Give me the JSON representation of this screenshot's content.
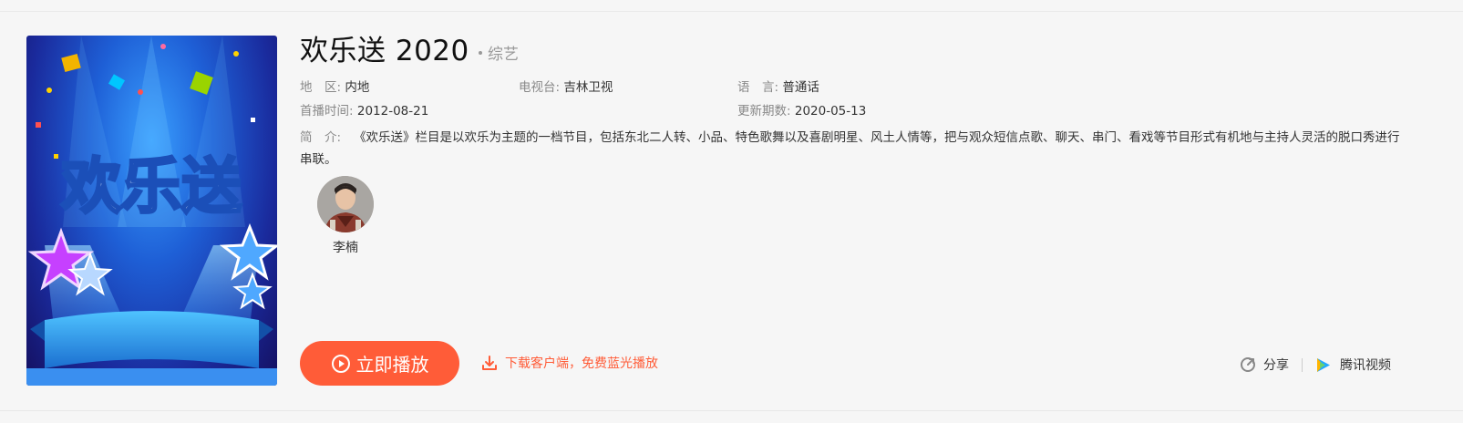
{
  "show": {
    "title": "欢乐送 2020",
    "genre": "综艺",
    "poster_text": "欢乐送"
  },
  "info": {
    "region_label": "地　区:",
    "region_value": "内地",
    "channel_label": "电视台:",
    "channel_value": "吉林卫视",
    "language_label": "语　言:",
    "language_value": "普通话",
    "premiere_label": "首播时间:",
    "premiere_value": "2012-08-21",
    "update_label": "更新期数:",
    "update_value": "2020-05-13",
    "desc_label": "简　介:",
    "desc_value": "《欢乐送》栏目是以欢乐为主题的一档节目，包括东北二人转、小品、特色歌舞以及喜剧明星、风土人情等，把与观众短信点歌、聊天、串门、看戏等节目形式有机地与主持人灵活的脱口秀进行串联。"
  },
  "cast": [
    {
      "name": "李楠"
    }
  ],
  "actions": {
    "play_label": "立即播放",
    "download_label": "下载客户端，免费蓝光播放",
    "share_label": "分享",
    "tencent_label": "腾讯视频"
  },
  "colors": {
    "accent": "#ff5c38",
    "background": "#f6f6f6"
  },
  "icons": {
    "play": "play-circle-icon",
    "download": "download-icon",
    "share": "share-icon",
    "tencent": "tencent-video-icon"
  }
}
